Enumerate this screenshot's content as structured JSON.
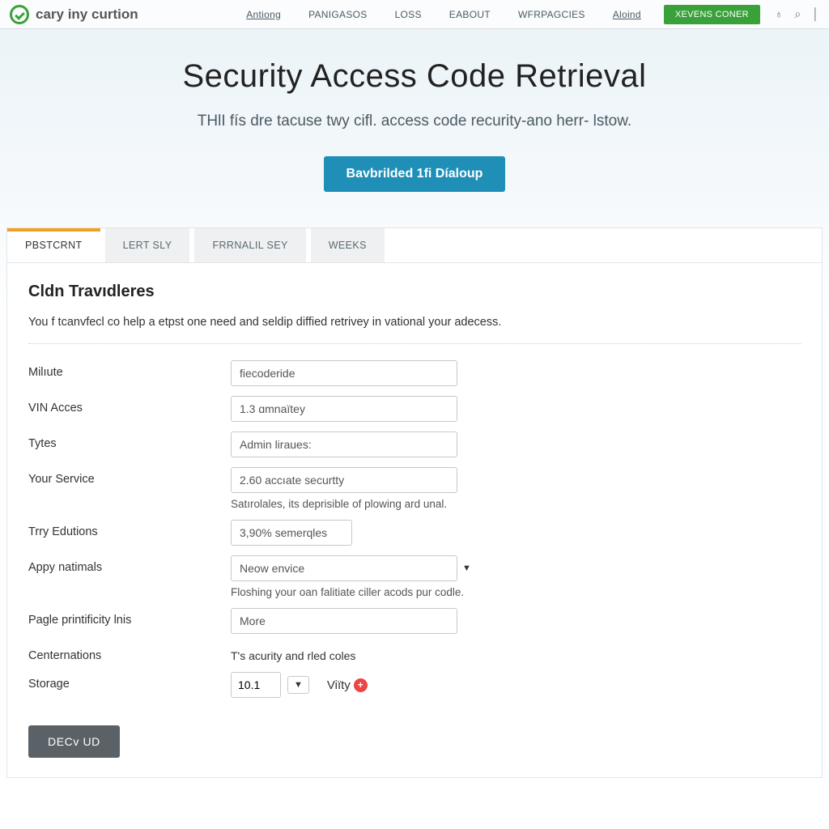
{
  "brand": {
    "name": "cary iny curtion"
  },
  "nav": {
    "items": [
      "Antiong",
      "PANIGASOS",
      "LOSS",
      "EABOUT",
      "WFRPAGCIES",
      "Aloind"
    ],
    "cta": "XEVENS CONER"
  },
  "hero": {
    "title": "Security Access Code Retrieval",
    "subtitle": "THlI fís dre tacuse twy cifl. access code recurity-ano herr- lstow.",
    "button": "Bavbrilded 1fi Díaloup"
  },
  "tabs": [
    "PBSTCRNT",
    "LERT SLY",
    "FRRNALIL SEY",
    "WEEKS"
  ],
  "panel": {
    "heading": "Cldn Travıdleres",
    "description": "You f tcanvfecl co help a etpst one need and seldip diffied retrivey in vational your adecess."
  },
  "form": {
    "rows": [
      {
        "label": "Milıute",
        "value": "fiecoderide"
      },
      {
        "label": "VIN Acces",
        "value": "1.3 ɑmnaïtey"
      },
      {
        "label": "Tytes",
        "value": "Admin liraues:"
      },
      {
        "label": "Your Service",
        "value": "2.60 accıate securtty",
        "help": "Satırolales, its deprisible of plowing ard unal."
      },
      {
        "label": "Trry Edutions",
        "value": "3,90% semerqles"
      },
      {
        "label": "Appy natimals",
        "value": "Neow envice",
        "help": "Floshing your oan falitiate ciller acods pur codle."
      },
      {
        "label": "Pagle printificity lnis",
        "value": "More"
      },
      {
        "label": "Centernations",
        "static": "T's acurity and rled coles"
      },
      {
        "label": "Storage",
        "small": "10.1",
        "tag": "Viïty"
      }
    ],
    "submit": "DECv UD"
  }
}
